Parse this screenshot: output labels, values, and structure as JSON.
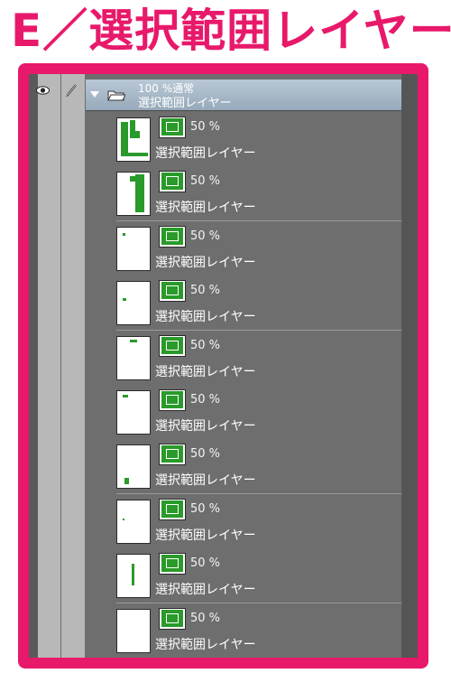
{
  "title": "E／選択範囲レイヤー",
  "colors": {
    "accent": "#e8196a",
    "selection_green": "#2a9a2a",
    "panel_bg": "#6e6e6e"
  },
  "group": {
    "opacity_blend": "100 %通常",
    "name": "選択範囲レイヤー",
    "icons": [
      "eye-icon",
      "pen-icon",
      "expand-caret-icon",
      "folder-icon"
    ]
  },
  "layers": [
    {
      "opacity": "50 %",
      "name": "選択範囲レイヤー",
      "icon": "selection-layer-icon"
    },
    {
      "opacity": "50 %",
      "name": "選択範囲レイヤー",
      "icon": "selection-layer-icon"
    },
    {
      "opacity": "50 %",
      "name": "選択範囲レイヤー",
      "icon": "selection-layer-icon"
    },
    {
      "opacity": "50 %",
      "name": "選択範囲レイヤー",
      "icon": "selection-layer-icon"
    },
    {
      "opacity": "50 %",
      "name": "選択範囲レイヤー",
      "icon": "selection-layer-icon"
    },
    {
      "opacity": "50 %",
      "name": "選択範囲レイヤー",
      "icon": "selection-layer-icon"
    },
    {
      "opacity": "50 %",
      "name": "選択範囲レイヤー",
      "icon": "selection-layer-icon"
    },
    {
      "opacity": "50 %",
      "name": "選択範囲レイヤー",
      "icon": "selection-layer-icon"
    },
    {
      "opacity": "50 %",
      "name": "選択範囲レイヤー",
      "icon": "selection-layer-icon"
    },
    {
      "opacity": "50 %",
      "name": "選択範囲レイヤー",
      "icon": "selection-layer-icon"
    }
  ]
}
